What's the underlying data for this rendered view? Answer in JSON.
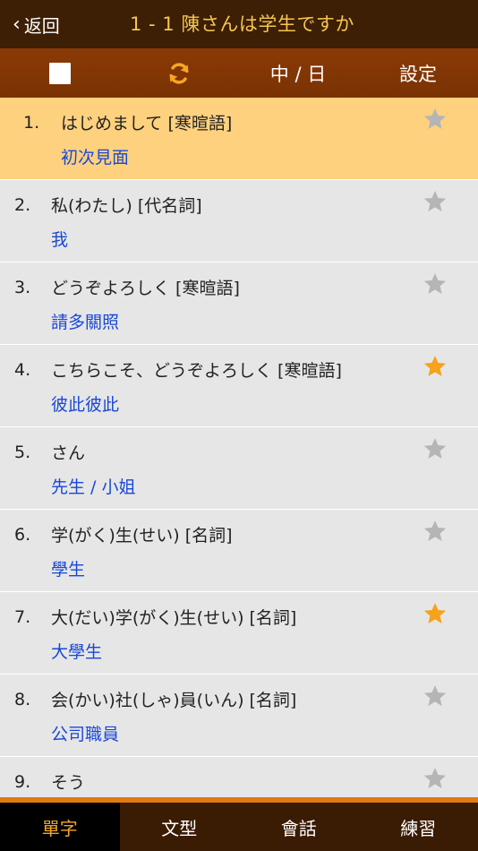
{
  "nav": {
    "back_label": "返回",
    "title": "1 - 1 陳さんは学生ですか"
  },
  "toolbar": {
    "lang_label": "中 / 日",
    "settings_label": "設定"
  },
  "colors": {
    "star_active": "#f7a21b",
    "star_inactive": "#b5b5b5"
  },
  "items": [
    {
      "num": "1.",
      "jp": "はじめまして  [寒暄語]",
      "cn": "初次見面",
      "starred": false,
      "selected": true
    },
    {
      "num": "2.",
      "jp": "私(わたし)  [代名詞]",
      "cn": "我",
      "starred": false,
      "selected": false
    },
    {
      "num": "3.",
      "jp": "どうぞよろしく  [寒暄語]",
      "cn": "請多關照",
      "starred": false,
      "selected": false
    },
    {
      "num": "4.",
      "jp": "こちらこそ、どうぞよろしく  [寒暄語]",
      "cn": "彼此彼此",
      "starred": true,
      "selected": false
    },
    {
      "num": "5.",
      "jp": "さん",
      "cn": "先生 / 小姐",
      "starred": false,
      "selected": false
    },
    {
      "num": "6.",
      "jp": "学(がく)生(せい)  [名詞]",
      "cn": "學生",
      "starred": false,
      "selected": false
    },
    {
      "num": "7.",
      "jp": "大(だい)学(がく)生(せい)  [名詞]",
      "cn": "大學生",
      "starred": true,
      "selected": false
    },
    {
      "num": "8.",
      "jp": "会(かい)社(しゃ)員(いん)  [名詞]",
      "cn": "公司職員",
      "starred": false,
      "selected": false
    },
    {
      "num": "9.",
      "jp": "そう",
      "cn": "",
      "starred": false,
      "selected": false
    }
  ],
  "tabs": [
    {
      "label": "單字",
      "active": true
    },
    {
      "label": "文型",
      "active": false
    },
    {
      "label": "會話",
      "active": false
    },
    {
      "label": "練習",
      "active": false
    }
  ]
}
